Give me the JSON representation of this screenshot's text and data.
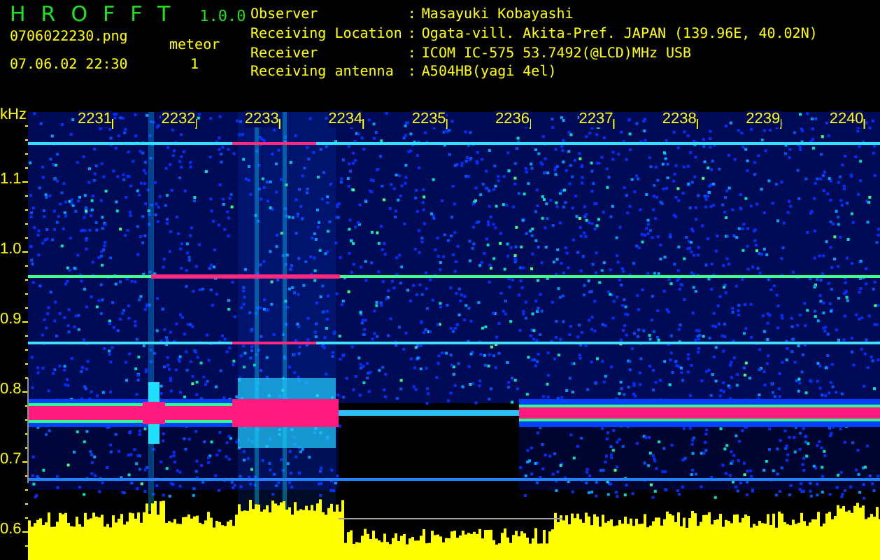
{
  "app": {
    "title": "HROFFT",
    "version": "1.0.0"
  },
  "file": {
    "name": "0706022230.png",
    "timestamp": "07.06.02 22:30"
  },
  "meteor": {
    "label": "meteor",
    "count": "1"
  },
  "station": [
    {
      "label": "Observer",
      "separator": ":",
      "value": "Masayuki Kobayashi"
    },
    {
      "label": "Receiving Location",
      "separator": ":",
      "value": "Ogata-vill. Akita-Pref. JAPAN (139.96E, 40.02N)"
    },
    {
      "label": "Receiver",
      "separator": ":",
      "value": "ICOM IC-575 53.7492(@LCD)MHz USB"
    },
    {
      "label": "Receiving antenna",
      "separator": ":",
      "value": "A504HB(yagi 4el)"
    }
  ],
  "frequency_axis": {
    "unit": "kHz",
    "labels": [
      "1.1",
      "1.0",
      "0.9",
      "0.8",
      "0.7",
      "0.6"
    ]
  },
  "time_axis": {
    "labels": [
      "2231",
      "2232",
      "2233",
      "2234",
      "2235",
      "2236",
      "2237",
      "2238",
      "2239",
      "2240"
    ]
  }
}
